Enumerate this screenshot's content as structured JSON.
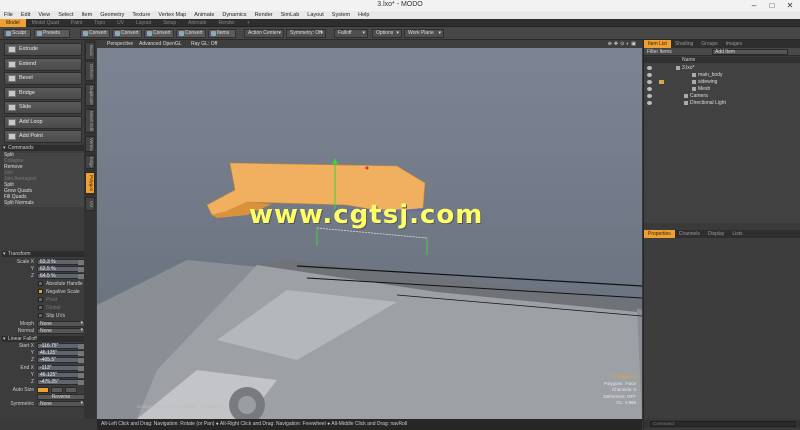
{
  "window": {
    "title": "3.lxo* - MODO"
  },
  "menu": [
    "File",
    "Edit",
    "View",
    "Select",
    "Item",
    "Geometry",
    "Texture",
    "Vertex Map",
    "Animate",
    "Dynamics",
    "Render",
    "SimLab",
    "Layout",
    "System",
    "Help"
  ],
  "layout_tabs": [
    {
      "label": "Model",
      "active": true
    },
    {
      "label": "Model Quad",
      "active": false
    },
    {
      "label": "Paint",
      "active": false
    },
    {
      "label": "Topo",
      "active": false
    },
    {
      "label": "UV",
      "active": false
    },
    {
      "label": "Layout",
      "active": false
    },
    {
      "label": "Setup",
      "active": false
    },
    {
      "label": "Animate",
      "active": false
    },
    {
      "label": "Render",
      "active": false
    },
    {
      "label": "+",
      "active": false
    }
  ],
  "toolbar": {
    "sculpt": "Sculpt",
    "presets": "Presets",
    "convert1": "Convert",
    "convert2": "Convert",
    "convert3": "Convert",
    "convert4": "Convert",
    "items": "Items",
    "action_center": "Action Center",
    "symmetry": "Symmetry: Off",
    "falloff": "Falloff",
    "options": "Options",
    "work_plane": "Work Plane"
  },
  "left_vtabs": [
    "Basic",
    "Deform",
    "Duplicate",
    "Mesh Edit",
    "Vertex",
    "Edge",
    "Polygon",
    "UV"
  ],
  "tools": [
    "Extrude",
    "Extend",
    "Bevel",
    "Bridge",
    "Slide",
    "Add Loop",
    "Add Point"
  ],
  "commands": {
    "header": "Commands",
    "items": [
      {
        "label": "Split",
        "dim": false
      },
      {
        "label": "Collapse",
        "dim": true
      },
      {
        "label": "Remove",
        "dim": false
      },
      {
        "label": "Join",
        "dim": true
      },
      {
        "label": "Join Averaged",
        "dim": true
      },
      {
        "label": "Split",
        "dim": false
      },
      {
        "label": "Grow Quads",
        "dim": false
      },
      {
        "label": "Fill Quads",
        "dim": false
      },
      {
        "label": "Split Normals",
        "dim": false
      }
    ]
  },
  "transform": {
    "header": "Transform",
    "scale_label": "Scale X",
    "y_label": "Y",
    "z_label": "Z",
    "scale_x": "63.3 %",
    "scale_y": "62.5 %",
    "scale_z": "64.5 %",
    "absolute_handle": "Absolute Handle",
    "negative_scale": "Negative Scale",
    "pivot": "Pivot",
    "global": "Global",
    "slip_uvs": "Slip UVs",
    "morph_label": "Morph",
    "morph_value": "None",
    "normal_label": "Normal",
    "normal_value": "None"
  },
  "linear_falloff": {
    "header": "Linear Falloff",
    "start_label": "Start X",
    "start_x": "-116.75\"",
    "start_y": "46.125\"",
    "start_z": "-405.5\"",
    "end_label": "End X",
    "end_x": "-113\"",
    "end_y": "46.125\"",
    "end_z": "-475.25\"",
    "autosize_label": "Auto Size",
    "reverse": "Reverse",
    "symmetric_label": "Symmetric",
    "symmetric_value": "None"
  },
  "viewport": {
    "view": "Perspective",
    "shading": "Advanced OpenGL",
    "rayg": "Ray GL: Off",
    "info": [
      "30 Polygons",
      "Polygons : Face",
      "Channels: 0",
      "Deformers: OFF",
      "GL: 4,986"
    ],
    "footer": "Custom Preset : Linear Falloff : Transform",
    "watermark": "www.cgtsj.com"
  },
  "status": "Alt-Left Click and Drag: Navigation: Rotate (or Pan) ● Alt-Right Click and Drag: Navigation: Freewheel ● Alt-Middle Click and Drag: navRoll",
  "right_top_tabs": [
    {
      "label": "Item List",
      "active": true
    },
    {
      "label": "Shading",
      "active": false
    },
    {
      "label": "Groups",
      "active": false
    },
    {
      "label": "Images",
      "active": false
    }
  ],
  "filter_label": "Filter Items",
  "add_item_label": "Add Item",
  "col_name": "Name",
  "tree": [
    {
      "label": "3.lxo*",
      "indent": 0,
      "eye": true,
      "lock": false
    },
    {
      "label": "main_body",
      "indent": 2,
      "eye": true,
      "lock": false
    },
    {
      "label": "sidewing",
      "indent": 2,
      "eye": true,
      "lock": true
    },
    {
      "label": "Mesh",
      "indent": 2,
      "eye": true,
      "lock": false
    },
    {
      "label": "Camera",
      "indent": 1,
      "eye": true,
      "lock": false
    },
    {
      "label": "Directional Light",
      "indent": 1,
      "eye": true,
      "lock": false
    }
  ],
  "right_bottom_tabs": [
    {
      "label": "Properties",
      "active": true
    },
    {
      "label": "Channels",
      "active": false
    },
    {
      "label": "Display",
      "active": false
    },
    {
      "label": "Lists",
      "active": false
    }
  ],
  "command_placeholder": "Command"
}
